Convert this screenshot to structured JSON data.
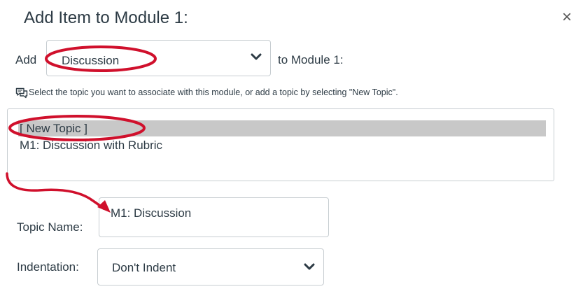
{
  "dialog": {
    "title": "Add Item to Module 1:",
    "close_label": "×"
  },
  "add_row": {
    "add_label": "Add",
    "type_select_value": "Discussion",
    "to_label": "to Module 1:"
  },
  "hint": "Select the topic you want to associate with this module, or add a topic by selecting \"New Topic\".",
  "topics": [
    {
      "label": "[ New Topic ]",
      "selected": true
    },
    {
      "label": "M1: Discussion with Rubric",
      "selected": false
    }
  ],
  "topic_name": {
    "label": "Topic Name:",
    "value": "M1: Discussion"
  },
  "indentation": {
    "label": "Indentation:",
    "value": "Don't Indent"
  },
  "colors": {
    "annotation": "#d0102c",
    "selected_option_bg": "#c8c8c8",
    "border": "#c7cdd1"
  }
}
